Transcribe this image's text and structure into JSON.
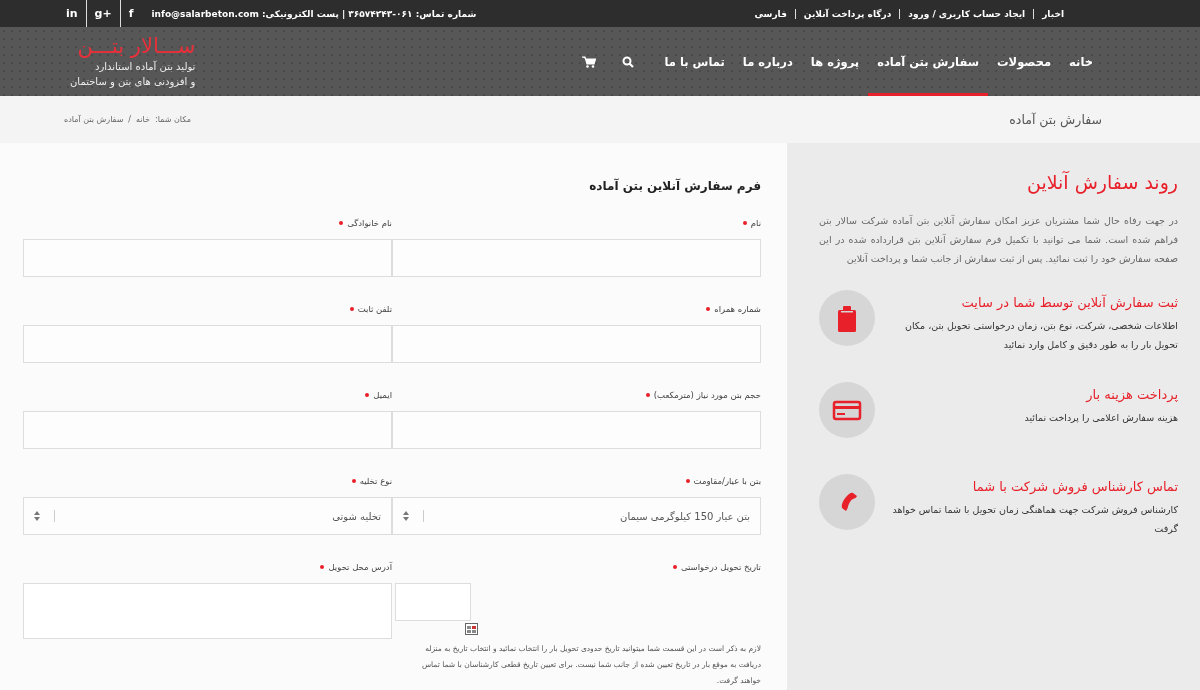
{
  "top_bar": {
    "links": [
      {
        "label": "اخبار"
      },
      {
        "label": "ایجاد حساب کاربری / ورود"
      },
      {
        "label": "درگاه پرداخت آنلاین"
      },
      {
        "label": "فارسی"
      }
    ],
    "contact": "شماره تماس: ۰۶۱-۳۶۵۷۴۲۴۳ | پست الکترونیکی: info@salarbeton.com",
    "social": [
      {
        "glyph": "f"
      },
      {
        "glyph": "g+"
      },
      {
        "glyph": "in"
      }
    ]
  },
  "header": {
    "logo": "ســـالار بتـــن",
    "tagline": [
      "تولید بتن آماده استاندارد",
      "و افزودنی های بتن و ساختمان"
    ],
    "nav": [
      {
        "label": "خانه",
        "selected": false
      },
      {
        "label": "محصولات",
        "selected": false
      },
      {
        "label": "سفارش بتن آماده",
        "selected": true
      },
      {
        "label": "پروژه ها",
        "selected": false
      },
      {
        "label": "درباره ما",
        "selected": false
      },
      {
        "label": "تماس با ما",
        "selected": false
      }
    ]
  },
  "page_title": "سفارش بتن آماده",
  "breadcrumb": {
    "prefix": "مکان شما:",
    "items": [
      "خانه",
      "سفارش بتن آماده"
    ],
    "separator": "/"
  },
  "form": {
    "title": "فرم سفارش آنلاین بتن آماده",
    "rows": [
      {
        "fields": [
          {
            "kind": "text",
            "label": "نام",
            "required": true
          },
          {
            "kind": "text",
            "label": "نام خانوادگی",
            "required": true
          }
        ]
      },
      {
        "fields": [
          {
            "kind": "text",
            "label": "شماره همراه",
            "required": true
          },
          {
            "kind": "text",
            "label": "تلفن ثابت",
            "required": true
          }
        ]
      },
      {
        "fields": [
          {
            "kind": "text",
            "label": "حجم بتن مورد نیاز (مترمکعب)",
            "required": true
          },
          {
            "kind": "text",
            "label": "ایمیل",
            "required": true
          }
        ]
      },
      {
        "fields": [
          {
            "kind": "select",
            "label": "بتن با عیار/مقاومت",
            "required": true,
            "value": "بتن عیار 150 کیلوگرمی سیمان"
          },
          {
            "kind": "select",
            "label": "نوع تخلیه",
            "required": true,
            "value": "تخلیه شوتی"
          }
        ]
      },
      {
        "fields": [
          {
            "kind": "date",
            "label": "تاریخ تحویل درخواستی",
            "required": true,
            "note": "لازم به ذکر است در این قسمت شما میتوانید تاریخ حدودی تحویل بار را انتخاب نمائید و انتخاب تاریخ به منزله دریافت به موقع بار در تاریخ تعیین شده از جانب شما نیست. برای تعیین تاریخ قطعی کارشناسان با شما تماس خواهند گرفت."
          },
          {
            "kind": "textarea",
            "label": "آدرس محل تحویل",
            "required": true
          }
        ]
      }
    ]
  },
  "sidebar": {
    "title": "روند سفارش آنلاین",
    "intro": "در جهت رفاه حال شما مشتریان عزیز امکان سفارش آنلاین بتن آماده شرکت سالار بتن فراهم شده است. شما می توانید با تکمیل فرم سفارش آنلاین بتن قرارداده شده در این صفحه سفارش خود را ثبت نمائید. پس از ثبت سفارش از جانب شما و پرداخت آنلاین",
    "steps": [
      {
        "kind": "clipboard",
        "title": "ثبت سفارش آنلاین توسط شما در سایت",
        "text": "اطلاعات شخصی، شرکت، نوع بتن، زمان درخواستی تحویل بتن، مکان تحویل بار را به طور دقیق و کامل وارد نمائید"
      },
      {
        "kind": "card",
        "title": "پرداخت هزینه بار",
        "text": "هزینه سفارش اعلامی را پرداخت نمائید"
      },
      {
        "kind": "phone",
        "title": "تماس کارشناس فروش شرکت با شما",
        "text": "کارشناس فروش شرکت جهت هماهنگی زمان تحویل با شما تماس خواهد گرفت"
      }
    ]
  }
}
